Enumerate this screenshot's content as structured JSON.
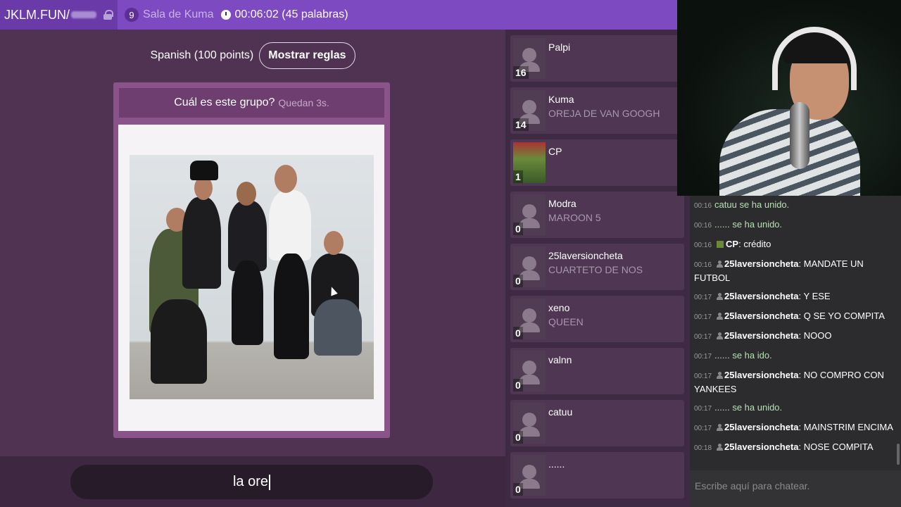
{
  "header": {
    "brand": "JKLM.FUN/",
    "room_count": "9",
    "room_name": "Sala de Kuma",
    "timer": "00:06:02 (45 palabras)"
  },
  "game": {
    "language": "Spanish (100 points)",
    "rules_button": "Mostrar reglas",
    "question": "Cuál es este grupo?",
    "remaining": "Quedan 3s.",
    "guess_value": "la ore"
  },
  "players": [
    {
      "name": "Palpi",
      "score": "16",
      "guess": ""
    },
    {
      "name": "Kuma",
      "score": "14",
      "guess": "OREJA DE VAN GOOGH"
    },
    {
      "name": "CP",
      "score": "1",
      "guess": ""
    },
    {
      "name": "Modra",
      "score": "0",
      "guess": "MAROON 5"
    },
    {
      "name": "25laversioncheta",
      "score": "0",
      "guess": "CUARTETO DE NOS"
    },
    {
      "name": "xeno",
      "score": "0",
      "guess": "QUEEN"
    },
    {
      "name": "valnn",
      "score": "0",
      "guess": ""
    },
    {
      "name": "catuu",
      "score": "0",
      "guess": ""
    },
    {
      "name": "......",
      "score": "0",
      "guess": ""
    }
  ],
  "chat": {
    "messages": [
      {
        "time": "00:16",
        "author": "",
        "text": "catuu se ha unido.",
        "system": true
      },
      {
        "time": "00:16",
        "author": "",
        "text": "...... se ha unido.",
        "system": true
      },
      {
        "time": "00:16",
        "author": "CP",
        "text": "crédito",
        "system": false,
        "icon": "cp"
      },
      {
        "time": "00:16",
        "author": "25laversioncheta",
        "text": "MANDATE UN FUTBOL",
        "system": false
      },
      {
        "time": "00:17",
        "author": "25laversioncheta",
        "text": "Y ESE",
        "system": false
      },
      {
        "time": "00:17",
        "author": "25laversioncheta",
        "text": "Q SE YO COMPITA",
        "system": false
      },
      {
        "time": "00:17",
        "author": "25laversioncheta",
        "text": "NOOO",
        "system": false
      },
      {
        "time": "00:17",
        "author": "",
        "text": "...... se ha ido.",
        "system": true
      },
      {
        "time": "00:17",
        "author": "25laversioncheta",
        "text": "NO COMPRO CON YANKEES",
        "system": false
      },
      {
        "time": "00:17",
        "author": "",
        "text": "...... se ha unido.",
        "system": true
      },
      {
        "time": "00:17",
        "author": "25laversioncheta",
        "text": "MAINSTRIM ENCIMA",
        "system": false
      },
      {
        "time": "00:18",
        "author": "25laversioncheta",
        "text": "NOSE COMPITA",
        "system": false
      }
    ],
    "placeholder": "Escribe aquí para chatear."
  },
  "colors": {
    "header": "#7d4ac2",
    "game_bg": "#503352",
    "card": "#8a538a",
    "chat_bg": "#2c2c2f"
  }
}
